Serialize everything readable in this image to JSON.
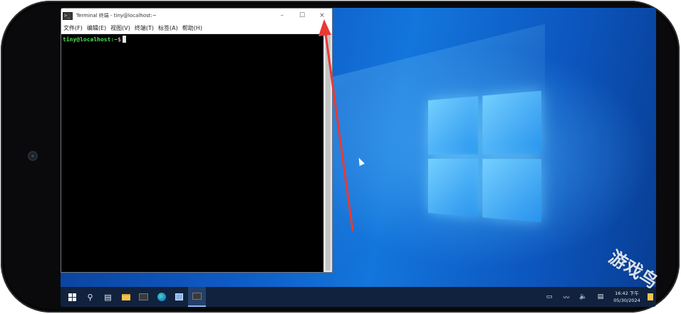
{
  "terminal": {
    "title": "Terminal 终端 - tiny@localhost:~",
    "icon": "terminal-icon",
    "window_controls": {
      "minimize": "–",
      "maximize": "☐",
      "close": "×"
    },
    "menu": [
      "文件(F)",
      "编辑(E)",
      "视图(V)",
      "终端(T)",
      "标签(A)",
      "帮助(H)"
    ],
    "prompt_user": "tiny@localhost:",
    "prompt_suffix": "~$"
  },
  "taskbar": {
    "icons": [
      "start-icon",
      "search-icon",
      "task-view-icon",
      "file-explorer-icon",
      "terminal-icon",
      "edge-icon",
      "store-icon",
      "terminal-app-icon"
    ],
    "tray": {
      "language_glyph": "▭",
      "network_glyph": "〰",
      "volume_glyph": "🔈",
      "notifications_glyph": "▤"
    },
    "clock": {
      "time": "16:42 下午",
      "date": "05/30/2024"
    }
  },
  "watermark": "游戏鸟",
  "colors": {
    "annotation_arrow": "#e83a35",
    "prompt_user": "#4ee04e",
    "taskbar": "#10223d"
  }
}
